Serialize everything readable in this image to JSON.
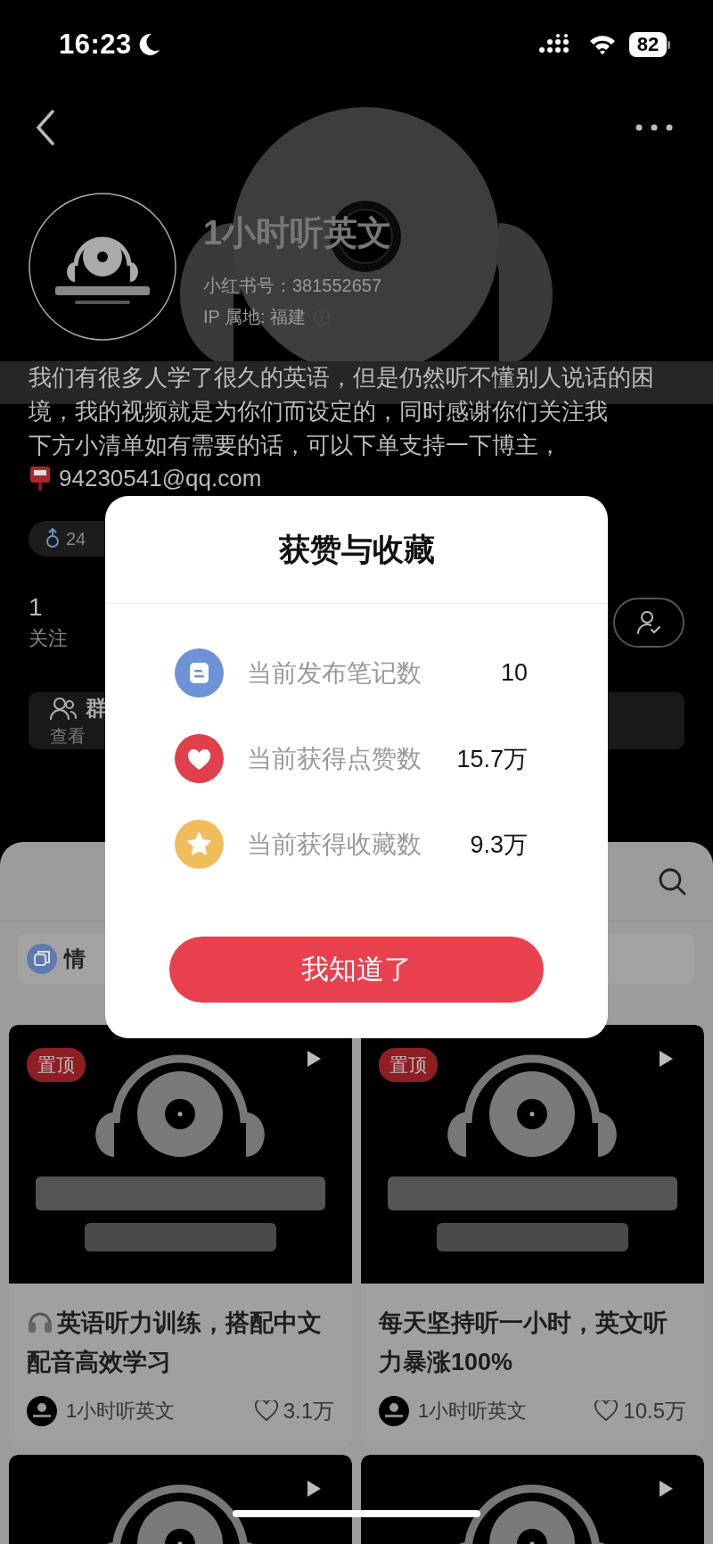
{
  "status_bar": {
    "time": "16:23",
    "battery": "82"
  },
  "profile": {
    "name": "1小时听英文",
    "red_id": "小红书号：381552657",
    "ip": "IP 属地: 福建",
    "bio": [
      "我们有很多人学了很久的英语，但是仍然听不懂别人说话的困境，我的视频就是为你们而设定的，同时感谢你们关注我",
      "下方小清单如有需要的话，可以下单支持一下博主，"
    ],
    "email": "94230541@qq.com",
    "tags": [
      "24"
    ],
    "stats": [
      {
        "count": "1",
        "label": "关注"
      }
    ],
    "group": {
      "title": "群",
      "subtitle": "查看"
    }
  },
  "notes_section": {
    "chips": [
      "情"
    ],
    "notes": [
      {
        "pinned": true,
        "badge": "置顶",
        "title": "英语听力训练，搭配中文配音高效学习",
        "author": "1小时听英文",
        "likes": "3.1万"
      },
      {
        "pinned": true,
        "badge": "置顶",
        "title": "每天坚持听一小时，英文听力暴涨100%",
        "author": "1小时听英文",
        "likes": "10.5万"
      },
      {
        "pinned": false
      },
      {
        "pinned": false
      }
    ]
  },
  "dialog": {
    "title": "获赞与收藏",
    "rows": [
      {
        "kind": "notes",
        "label": "当前发布笔记数",
        "value": "10"
      },
      {
        "kind": "likes",
        "label": "当前获得点赞数",
        "value": "15.7万"
      },
      {
        "kind": "collects",
        "label": "当前获得收藏数",
        "value": "9.3万"
      }
    ],
    "button": "我知道了"
  }
}
